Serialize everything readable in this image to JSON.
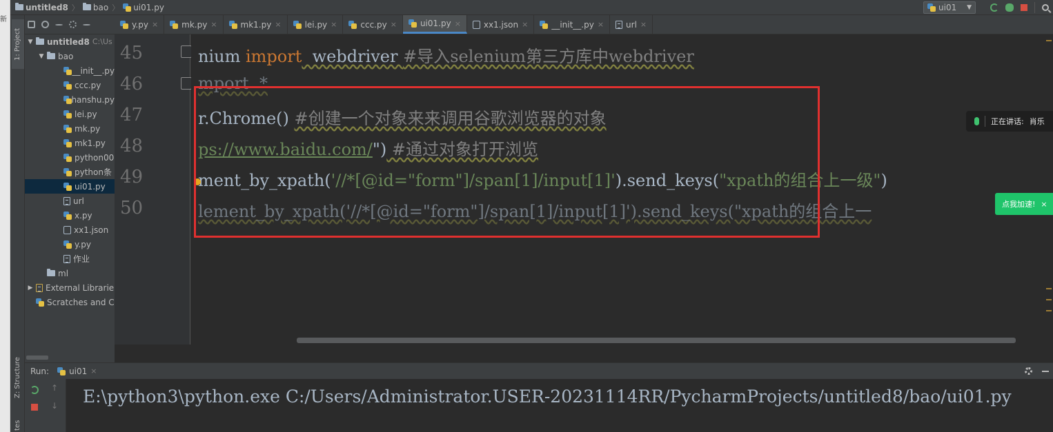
{
  "breadcrumb": {
    "project": "untitled8",
    "folder": "bao",
    "file": "ui01.py"
  },
  "run_config": {
    "label": "ui01"
  },
  "side_tabs": {
    "project": "1: Project",
    "structure": "Z: Structure",
    "favorites": "tes"
  },
  "left_fragment": "新",
  "project_tree": [
    {
      "label": "untitled8",
      "hint": "C:\\Us",
      "type": "folder",
      "depth": 0,
      "expanded": true,
      "bold": true
    },
    {
      "label": "bao",
      "type": "folder",
      "depth": 1,
      "expanded": true
    },
    {
      "label": "__init__.py",
      "type": "py",
      "depth": 2
    },
    {
      "label": "ccc.py",
      "type": "py",
      "depth": 2
    },
    {
      "label": "hanshu.py",
      "type": "py",
      "depth": 2
    },
    {
      "label": "lei.py",
      "type": "py",
      "depth": 2
    },
    {
      "label": "mk.py",
      "type": "py",
      "depth": 2
    },
    {
      "label": "mk1.py",
      "type": "py",
      "depth": 2
    },
    {
      "label": "python00",
      "type": "py",
      "depth": 2
    },
    {
      "label": "python条",
      "type": "py",
      "depth": 2
    },
    {
      "label": "ui01.py",
      "type": "py",
      "depth": 2,
      "selected": true
    },
    {
      "label": "url",
      "type": "txt",
      "depth": 2
    },
    {
      "label": "x.py",
      "type": "py",
      "depth": 2
    },
    {
      "label": "xx1.json",
      "type": "json",
      "depth": 2
    },
    {
      "label": "y.py",
      "type": "py",
      "depth": 2
    },
    {
      "label": "作业",
      "type": "txt",
      "depth": 2
    },
    {
      "label": "ml",
      "type": "folder",
      "depth": 1
    },
    {
      "label": "External Librarie",
      "type": "lib",
      "depth": 0,
      "collapsed": true
    },
    {
      "label": "Scratches and C",
      "type": "scratch",
      "depth": 0
    }
  ],
  "editor_tabs": [
    {
      "label": "y.py",
      "type": "py"
    },
    {
      "label": "mk.py",
      "type": "py"
    },
    {
      "label": "mk1.py",
      "type": "py"
    },
    {
      "label": "lei.py",
      "type": "py"
    },
    {
      "label": "ccc.py",
      "type": "py"
    },
    {
      "label": "ui01.py",
      "type": "py",
      "active": true
    },
    {
      "label": "xx1.json",
      "type": "json"
    },
    {
      "label": "__init__.py",
      "type": "py"
    },
    {
      "label": "url",
      "type": "txt"
    }
  ],
  "line_numbers": [
    "45",
    "46",
    "47",
    "48",
    "49",
    "50"
  ],
  "code": {
    "l45": {
      "a": "nium ",
      "kw": "import",
      "b": "  webdriver ",
      "comment": "#导入selenium第三方库中webdriver"
    },
    "l46": {
      "a": "mport  *"
    },
    "l47": {
      "a": "r.Chrome() ",
      "comment": "#创建一个对象来来调用谷歌浏览器的对象"
    },
    "l48": {
      "url": "ps://www.baidu.com/",
      "b": "\")",
      "comment": " #通过对象打开浏览"
    },
    "l49": {
      "a": "ment_by_xpath(",
      "s1": "'//*[@id=\"form\"]/span[1]/input[1]'",
      "b": ").send_keys(",
      "s2": "\"xpath的组合上一级\"",
      "c": ")"
    },
    "l50": {
      "a": "lement_by_xpath('//*[@id=\"form\"]/span[1]/input[1]').send_keys(\"xpath的组合上一"
    }
  },
  "overlays": {
    "voice_label": "正在讲话:",
    "voice_name": "肖乐",
    "speed_label": "点我加速!",
    "speed_close": "×"
  },
  "run_panel": {
    "label": "Run:",
    "tab": "ui01",
    "console": "E:\\python3\\python.exe C:/Users/Administrator.USER-20231114RR/PycharmProjects/untitled8/bao/ui01.py"
  },
  "close_glyph": "×",
  "colors": {
    "keyword": "#cc7832",
    "comment": "#808080",
    "string": "#6a8759",
    "highlight_box": "#e0302f",
    "accent": "#4a88c7"
  }
}
